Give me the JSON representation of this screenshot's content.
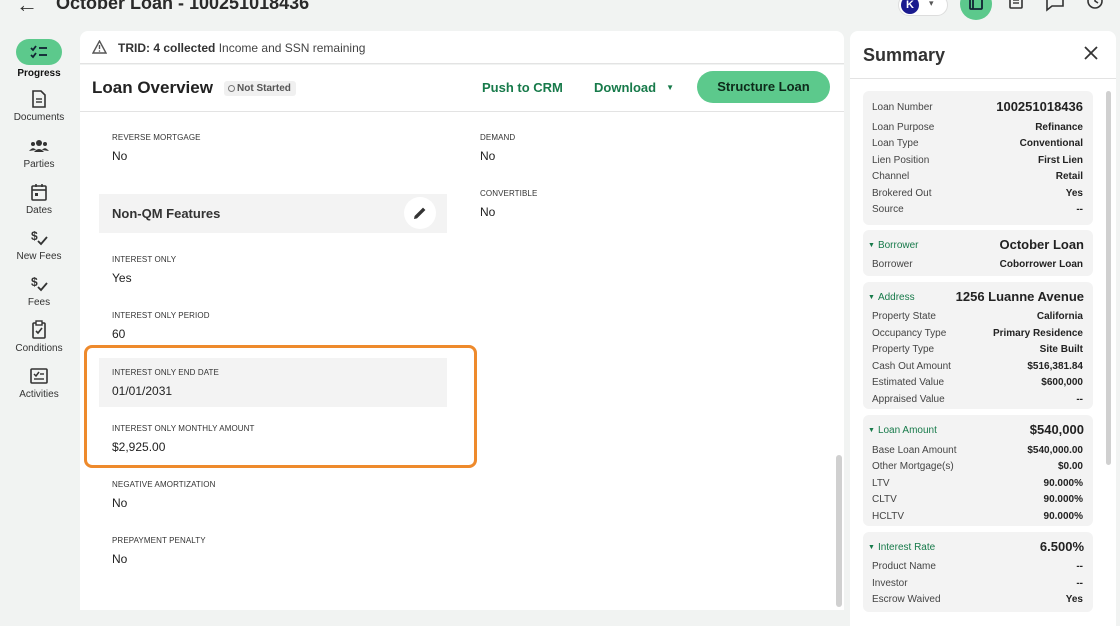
{
  "header": {
    "title": "October Loan - 100251018436",
    "avatar_initial": "K"
  },
  "rail": {
    "items": [
      {
        "label": "Progress",
        "icon": "checklist-icon"
      },
      {
        "label": "Documents",
        "icon": "document-icon"
      },
      {
        "label": "Parties",
        "icon": "people-icon"
      },
      {
        "label": "Dates",
        "icon": "calendar-icon"
      },
      {
        "label": "New Fees",
        "icon": "dollar-check-icon"
      },
      {
        "label": "Fees",
        "icon": "dollar-check-icon"
      },
      {
        "label": "Conditions",
        "icon": "clipboard-check-icon"
      },
      {
        "label": "Activities",
        "icon": "activity-list-icon"
      }
    ]
  },
  "trid": {
    "bold": "TRID: 4 collected",
    "rest": "Income and SSN remaining"
  },
  "main": {
    "title": "Loan Overview",
    "status": "Not Started",
    "push_crm": "Push to CRM",
    "download": "Download",
    "structure": "Structure Loan"
  },
  "fields": {
    "reverse_mortgage": {
      "label": "REVERSE MORTGAGE",
      "value": "No"
    },
    "demand": {
      "label": "DEMAND",
      "value": "No"
    },
    "convertible": {
      "label": "CONVERTIBLE",
      "value": "No"
    },
    "section_title": "Non-QM Features",
    "interest_only": {
      "label": "INTEREST ONLY",
      "value": "Yes"
    },
    "interest_only_period": {
      "label": "INTEREST ONLY PERIOD",
      "value": "60"
    },
    "interest_only_end_date": {
      "label": "INTEREST ONLY END DATE",
      "value": "01/01/2031"
    },
    "interest_only_monthly": {
      "label": "INTEREST ONLY MONTHLY AMOUNT",
      "value": "$2,925.00"
    },
    "negative_amortization": {
      "label": "NEGATIVE AMORTIZATION",
      "value": "No"
    },
    "prepayment_penalty": {
      "label": "PREPAYMENT PENALTY",
      "value": "No"
    }
  },
  "summary": {
    "title": "Summary",
    "loan": [
      {
        "label": "Loan Number",
        "value": "100251018436"
      },
      {
        "label": "Loan Purpose",
        "value": "Refinance"
      },
      {
        "label": "Loan Type",
        "value": "Conventional"
      },
      {
        "label": "Lien Position",
        "value": "First Lien"
      },
      {
        "label": "Channel",
        "value": "Retail"
      },
      {
        "label": "Brokered Out",
        "value": "Yes"
      },
      {
        "label": "Source",
        "value": "--"
      }
    ],
    "borrower": {
      "head": "Borrower",
      "head_value": "October Loan",
      "rows": [
        {
          "label": "Borrower",
          "value": "Coborrower Loan"
        }
      ]
    },
    "address": {
      "head": "Address",
      "head_value": "1256 Luanne Avenue",
      "rows": [
        {
          "label": "Property State",
          "value": "California"
        },
        {
          "label": "Occupancy Type",
          "value": "Primary Residence"
        },
        {
          "label": "Property Type",
          "value": "Site Built"
        },
        {
          "label": "Cash Out Amount",
          "value": "$516,381.84"
        },
        {
          "label": "Estimated Value",
          "value": "$600,000"
        },
        {
          "label": "Appraised Value",
          "value": "--"
        }
      ]
    },
    "loan_amount": {
      "head": "Loan Amount",
      "head_value": "$540,000",
      "rows": [
        {
          "label": "Base Loan Amount",
          "value": "$540,000.00"
        },
        {
          "label": "Other Mortgage(s)",
          "value": "$0.00"
        },
        {
          "label": "LTV",
          "value": "90.000%"
        },
        {
          "label": "CLTV",
          "value": "90.000%"
        },
        {
          "label": "HCLTV",
          "value": "90.000%"
        }
      ]
    },
    "interest_rate": {
      "head": "Interest Rate",
      "head_value": "6.500%",
      "rows": [
        {
          "label": "Product Name",
          "value": "--"
        },
        {
          "label": "Investor",
          "value": "--"
        },
        {
          "label": "Escrow Waived",
          "value": "Yes"
        }
      ]
    }
  }
}
